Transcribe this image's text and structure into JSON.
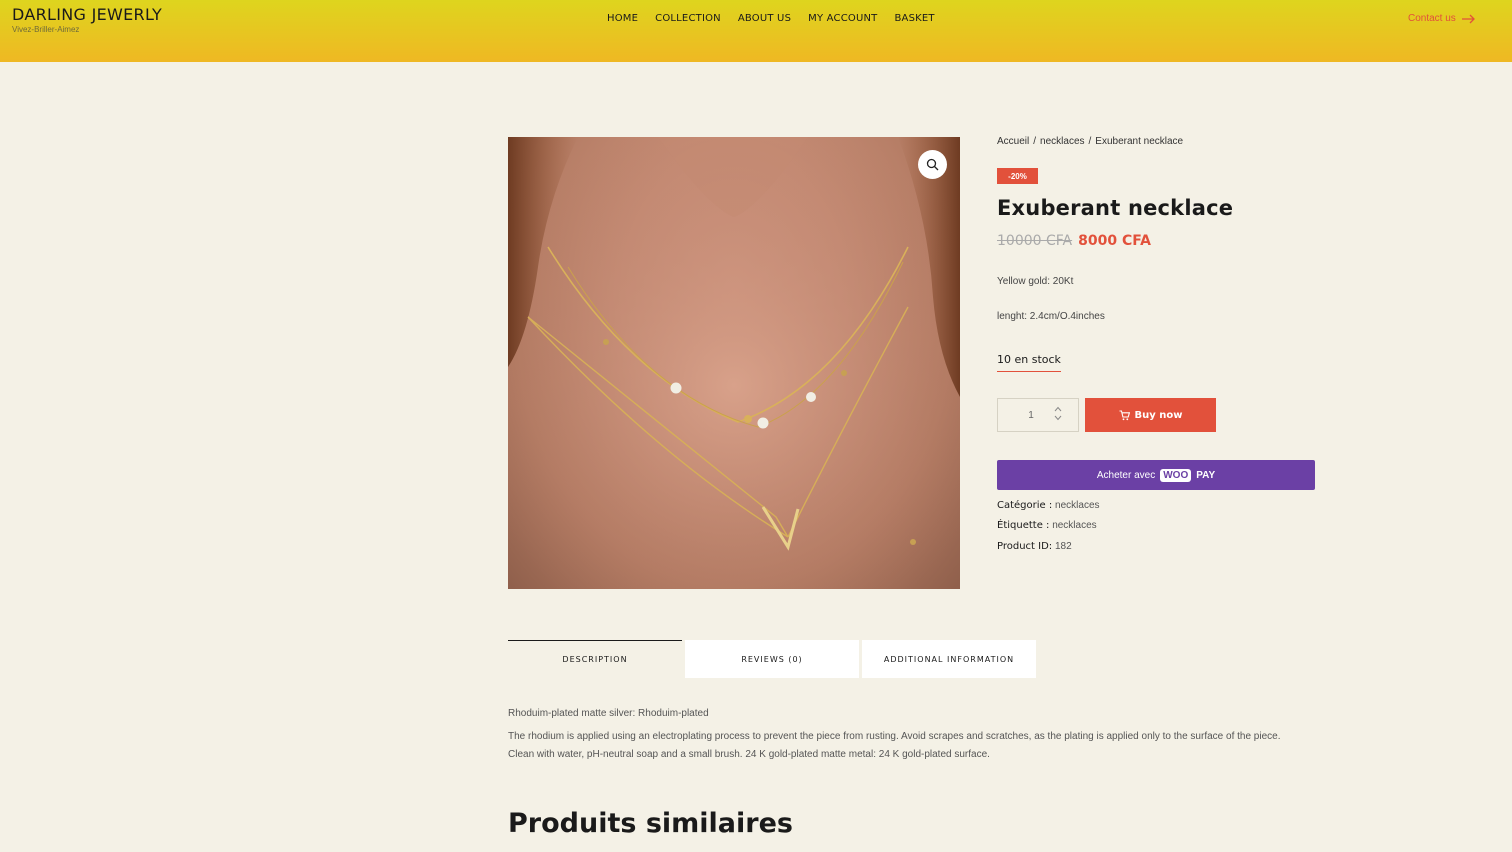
{
  "header": {
    "brand_name": "DARLING JEWERLY",
    "brand_tagline": "Vivez-Briller-Aimez",
    "nav": [
      "HOME",
      "COLLECTION",
      "ABOUT US",
      "MY ACCOUNT",
      "BASKET"
    ],
    "contact_label": "Contact us"
  },
  "breadcrumb": {
    "home": "Accueil",
    "sep1": "/",
    "category": "necklaces",
    "sep2": "/",
    "current": "Exuberant necklace"
  },
  "product": {
    "sale_badge": "-20%",
    "title": "Exuberant necklace",
    "old_price": "10000 CFA",
    "new_price": "8000 CFA",
    "spec_gold": "Yellow gold: 20Kt",
    "spec_length": "lenght: 2.4cm/O.4inches",
    "stock": "10 en stock",
    "quantity": "1",
    "buy_label": "Buy now",
    "woopay_prefix": "Acheter avec",
    "woopay_logo": "WOO",
    "woopay_pay": "PAY",
    "category_key": "Catégorie :",
    "category_val": "necklaces",
    "tag_key": "Étiquette :",
    "tag_val": "necklaces",
    "id_key": "Product ID:",
    "id_val": "182"
  },
  "tabs": [
    "DESCRIPTION",
    "REVIEWS (0)",
    "ADDITIONAL INFORMATION"
  ],
  "description": {
    "line1": "Rhoduim-plated matte silver: Rhoduim-plated",
    "para": "The rhodium is applied using an electroplating process to prevent the piece from rusting. Avoid scrapes and scratches, as the plating is applied only to the surface of the piece. Clean with water, pH-neutral soap and a small brush. 24 K gold-plated matte metal: 24 K gold-plated surface."
  },
  "similar_title": "Produits similaires",
  "colors": {
    "accent": "#e2513b",
    "header_top": "#ded51e",
    "header_bottom": "#efb823",
    "woopay": "#6b40a5",
    "background": "#f4f1e6"
  }
}
